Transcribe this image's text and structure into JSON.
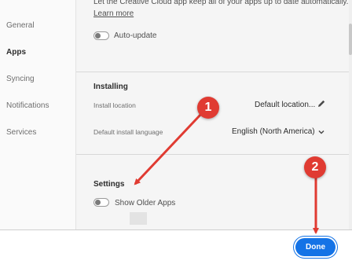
{
  "sidebar": {
    "items": [
      {
        "label": "General"
      },
      {
        "label": "Apps"
      },
      {
        "label": "Syncing"
      },
      {
        "label": "Notifications"
      },
      {
        "label": "Services"
      }
    ]
  },
  "autoupdate": {
    "description": "Let the Creative Cloud app keep all of your apps up to date automatically.",
    "learn_more": "Learn more",
    "toggle_label": "Auto-update"
  },
  "installing": {
    "heading": "Installing",
    "location_label": "Install location",
    "location_value": "Default location...",
    "language_label": "Default install language",
    "language_value": "English (North America)"
  },
  "settings": {
    "heading": "Settings",
    "toggle_label": "Show Older Apps"
  },
  "footer": {
    "done_label": "Done"
  },
  "annotations": [
    {
      "number": "1"
    },
    {
      "number": "2"
    }
  ],
  "colors": {
    "accent": "#1473e6",
    "annotation": "#e03b32"
  }
}
